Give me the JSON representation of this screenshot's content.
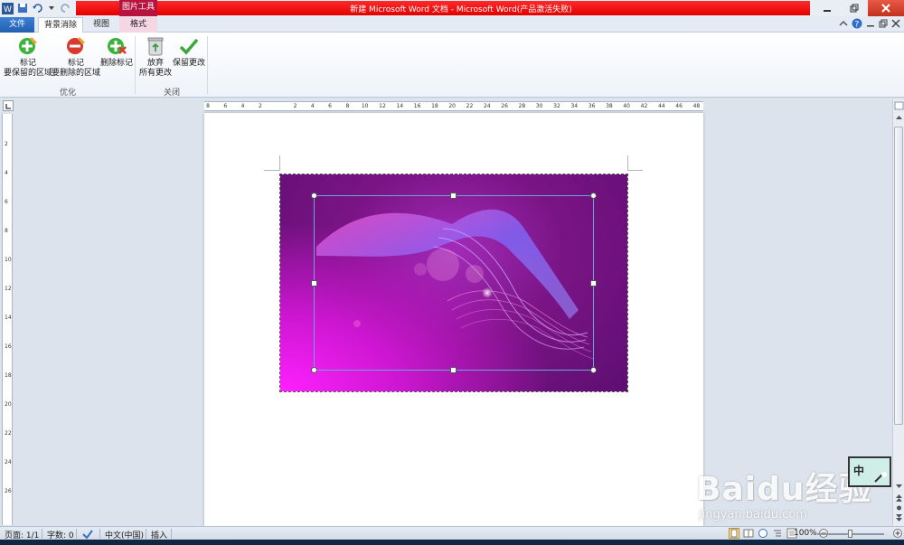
{
  "window": {
    "title": "新建 Microsoft Word 文档  -  Microsoft Word(产品激活失败)",
    "contextual_tab_group": "图片工具",
    "accent_color": "#e30000",
    "context_color": "#b7133e"
  },
  "tabs": [
    {
      "label": "文件",
      "active": false
    },
    {
      "label": "背景消除",
      "active": true
    },
    {
      "label": "视图",
      "active": false
    },
    {
      "label": "格式",
      "active": false
    }
  ],
  "ribbon": {
    "groups": [
      {
        "label": "优化",
        "buttons": [
          {
            "line1": "标记",
            "line2": "要保留的区域",
            "icon": "plus-pencil-icon"
          },
          {
            "line1": "标记",
            "line2": "要删除的区域",
            "icon": "minus-pencil-icon"
          },
          {
            "line1": "删除标记",
            "line2": "",
            "icon": "delete-mark-icon"
          }
        ]
      },
      {
        "label": "关闭",
        "buttons": [
          {
            "line1": "放弃",
            "line2": "所有更改",
            "icon": "discard-recycle-icon"
          },
          {
            "line1": "保留更改",
            "line2": "",
            "icon": "checkmark-icon"
          }
        ]
      }
    ]
  },
  "ruler": {
    "h_numbers": [
      "8",
      "6",
      "4",
      "2",
      "",
      "2",
      "4",
      "6",
      "8",
      "10",
      "12",
      "14",
      "16",
      "18",
      "20",
      "22",
      "24",
      "26",
      "28",
      "30",
      "32",
      "34",
      "36",
      "38",
      "40",
      "42",
      "44",
      "46",
      "48"
    ],
    "v_numbers": [
      "2",
      "4",
      "6",
      "8",
      "10",
      "12",
      "14",
      "16",
      "18",
      "20",
      "22",
      "24",
      "26"
    ]
  },
  "status": {
    "page": "页面: 1/1",
    "words": "字数: 0",
    "language": "中文(中国)",
    "mode": "插入",
    "zoom": "100%",
    "zoom_level": 0.5
  },
  "ime": {
    "label": "中"
  },
  "watermark": {
    "logo": "Baidu经验",
    "url": "jingyan.baidu.com"
  }
}
